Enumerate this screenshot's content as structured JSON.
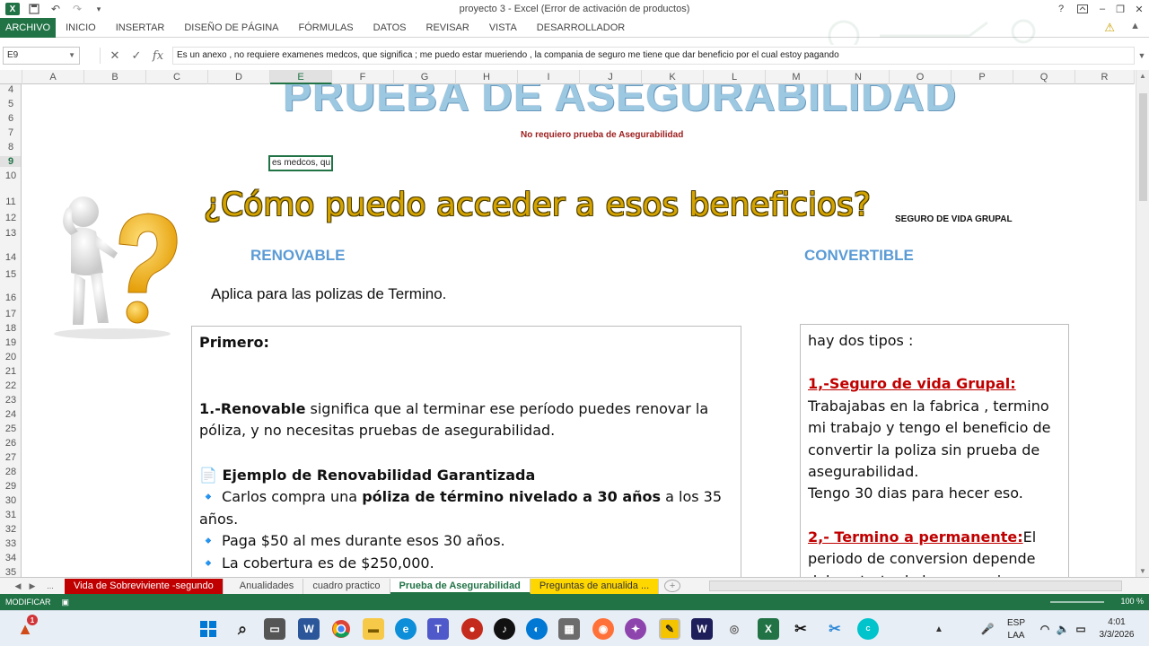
{
  "window": {
    "title": "proyecto 3 - Excel (Error de activación de productos)",
    "help": "?",
    "minimize": "–",
    "restore": "❐",
    "close": "✕"
  },
  "ribbon": {
    "tabs": [
      "ARCHIVO",
      "INICIO",
      "INSERTAR",
      "DISEÑO DE PÁGINA",
      "FÓRMULAS",
      "DATOS",
      "REVISAR",
      "VISTA",
      "DESARROLLADOR"
    ]
  },
  "formula_bar": {
    "name_box": "E9",
    "fx": "fx",
    "cancel": "✕",
    "enter": "✓",
    "content": "Es un anexo , no requiere examenes medcos,  que significa ; me puedo estar mueriendo , la compania de seguro me tiene que dar beneficio por el cual estoy pagando"
  },
  "grid": {
    "columns": [
      "A",
      "B",
      "C",
      "D",
      "E",
      "F",
      "G",
      "H",
      "I",
      "J",
      "K",
      "L",
      "M",
      "N",
      "O",
      "P",
      "Q",
      "R"
    ],
    "rows": [
      "4",
      "5",
      "6",
      "7",
      "8",
      "9",
      "10",
      "11",
      "12",
      "13",
      "14",
      "15",
      "16",
      "17",
      "18",
      "19",
      "20",
      "21",
      "22",
      "23",
      "24",
      "25",
      "26",
      "27",
      "28",
      "29",
      "30",
      "31",
      "32",
      "33",
      "34",
      "35"
    ],
    "active_cell": "E9"
  },
  "sheet": {
    "big_title": "PRUEBA DE ASEGURABILIDAD",
    "subtitle": "No requiero prueba de Asegurabilidad",
    "edit_cell_text": "es medcos,  qu",
    "question": "¿Cómo puedo acceder a esos beneficios?",
    "seguro_grupal": "SEGURO DE VIDA GRUPAL",
    "renovable": "RENOVABLE",
    "convertible": "CONVERTIBLE",
    "aplica": "Aplica para las polizas de Termino."
  },
  "textbox_left": {
    "primero": "Primero:",
    "renovable_bold": "1.-Renovable",
    "renovable_rest": " significa que al terminar ese período puedes renovar la póliza, y no necesitas pruebas de asegurabilidad.",
    "ejemplo_icon": "📄",
    "ejemplo_title": "Ejemplo de Renovabilidad Garantizada",
    "bullet": "🔹",
    "line1_a": "Carlos compra una ",
    "line1_b": "póliza de término nivelado a 30 años",
    "line1_c": " a los 35 años.",
    "line2": "Paga $50 al mes durante esos 30 años.",
    "line3": "La cobertura es de $250,000."
  },
  "textbox_right": {
    "hay": "hay dos tipos :",
    "tipo1": "1,-Seguro de vida Grupal:",
    "tipo1_text": "Trabajabas en la fabrica , termino mi trabajo y tengo el beneficio de convertir la poliza sin prueba de asegurabilidad.",
    "dias": "Tengo 30 dias para hecer eso.",
    "tipo2": "2,- Termino a permanente:",
    "tipo2_text": "El periodo de conversion depende del contrato de la compania"
  },
  "sheet_tabs": {
    "ellipsis": "...",
    "tabs": [
      "Vida de Sobreviviente -segundo",
      "Anualidades",
      "cuadro practico",
      "Prueba de Asegurabilidad",
      "Preguntas de anualida ..."
    ]
  },
  "status": {
    "mode": "MODIFICAR",
    "zoom": "100 %"
  },
  "taskbar": {
    "lang1": "ESP",
    "lang2": "LAA",
    "time": "4:01",
    "date": "3/3/2026",
    "badge": "1"
  },
  "colors": {
    "excel_green": "#217346",
    "title_blue": "#9cc8e2",
    "section_blue": "#5b9bd5",
    "question_gold": "#d4a300",
    "red": "#c00000"
  }
}
